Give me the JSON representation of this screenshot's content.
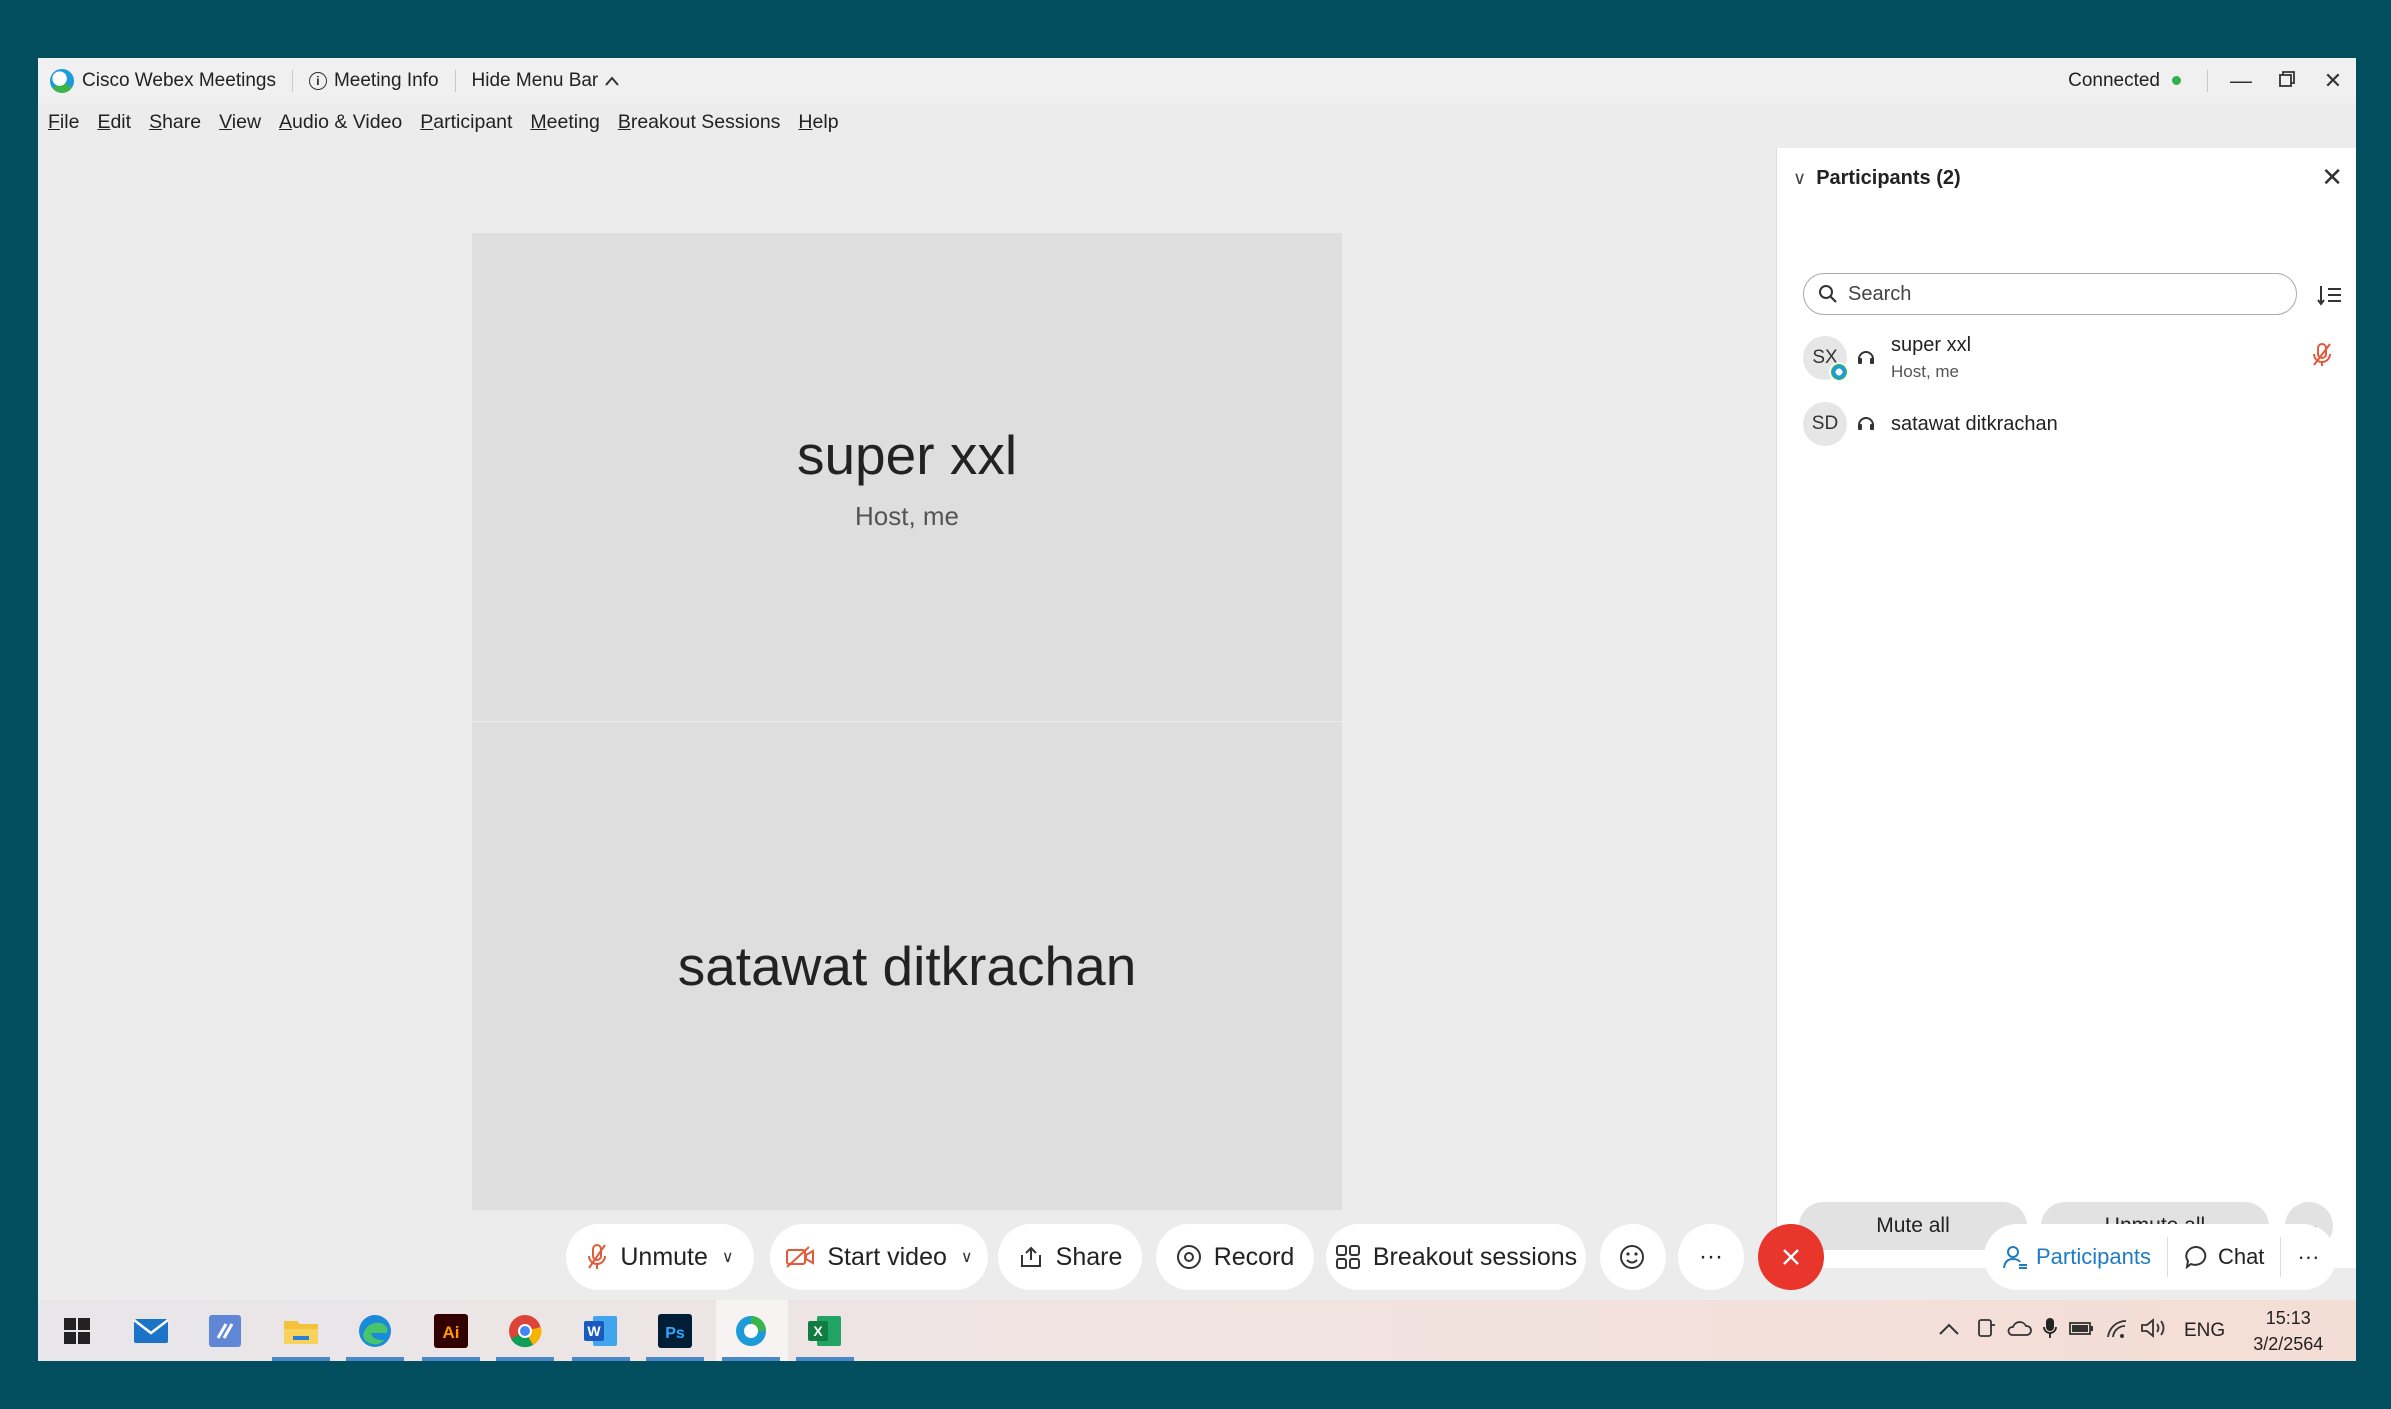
{
  "window": {
    "app_title": "Cisco Webex Meetings",
    "meeting_info": "Meeting Info",
    "hide_menu_bar": "Hide Menu Bar",
    "status": "Connected"
  },
  "menu": [
    "File",
    "Edit",
    "Share",
    "View",
    "Audio & Video",
    "Participant",
    "Meeting",
    "Breakout Sessions",
    "Help"
  ],
  "video": {
    "tiles": [
      {
        "name": "super xxl",
        "role": "Host, me"
      },
      {
        "name": "satawat ditkrachan",
        "role": ""
      }
    ]
  },
  "participants_panel": {
    "title": "Participants (2)",
    "search_placeholder": "Search",
    "list": [
      {
        "initials": "SX",
        "name": "super xxl",
        "role": "Host, me",
        "muted": true
      },
      {
        "initials": "SD",
        "name": "satawat ditkrachan",
        "role": "",
        "muted": false
      }
    ],
    "mute_all": "Mute all",
    "unmute_all": "Unmute all",
    "more": "···"
  },
  "controls": {
    "unmute": "Unmute",
    "start_video": "Start video",
    "share": "Share",
    "record": "Record",
    "breakout": "Breakout sessions",
    "more": "···",
    "participants": "Participants",
    "chat": "Chat"
  },
  "colors": {
    "accent": "#1e7bc4",
    "end": "#e8362c",
    "mute_red": "#e15a3a",
    "connected": "#2fb24d"
  },
  "taskbar": {
    "apps": [
      "start-icon",
      "mail-icon",
      "app-icon",
      "file-explorer-icon",
      "edge-icon",
      "illustrator-icon",
      "chrome-icon",
      "word-icon",
      "photoshop-icon",
      "webex-icon",
      "excel-icon"
    ],
    "lang": "ENG",
    "time": "15:13",
    "date": "3/2/2564"
  }
}
